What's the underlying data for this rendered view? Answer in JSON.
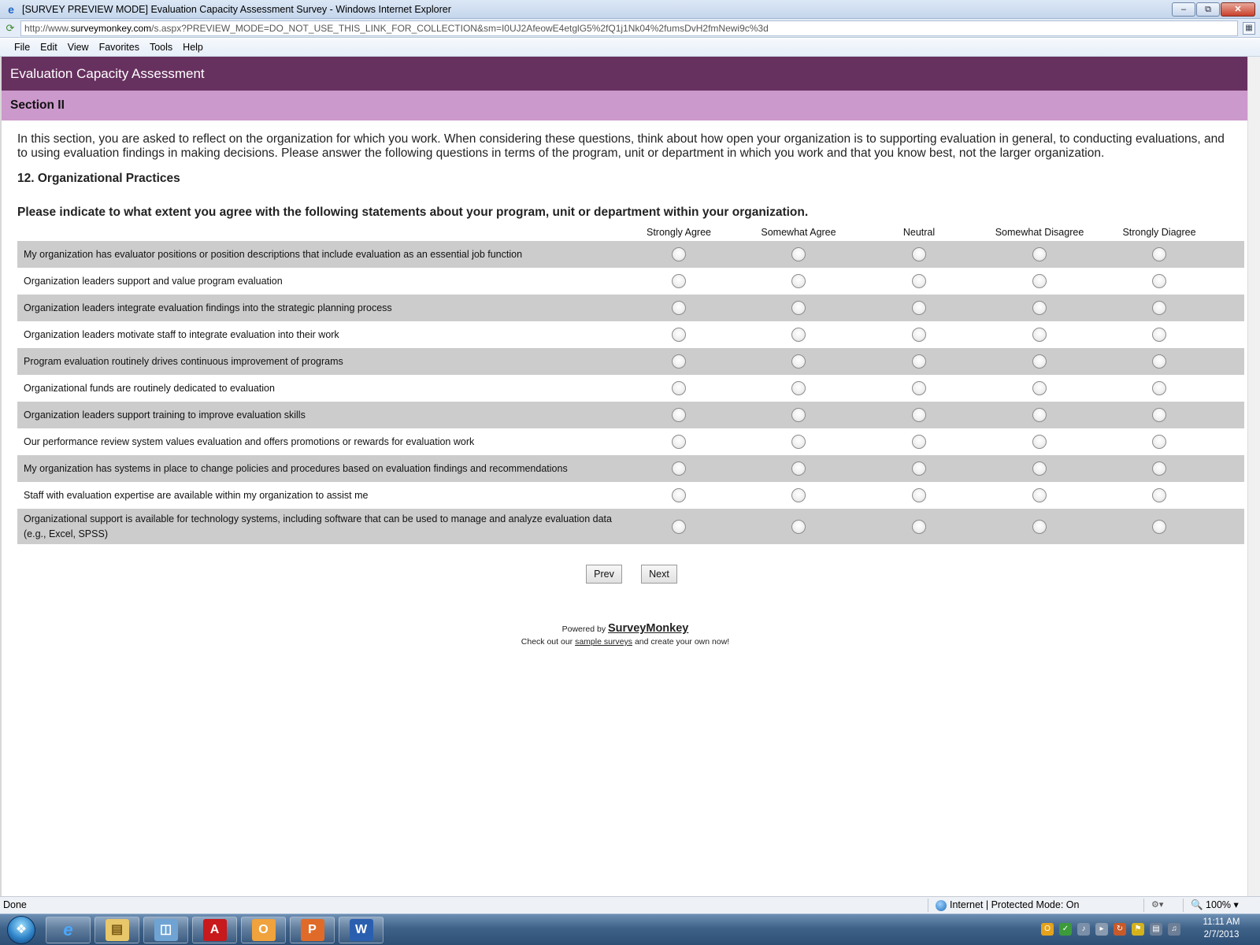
{
  "window": {
    "title": "[SURVEY PREVIEW MODE] Evaluation Capacity Assessment Survey - Windows Internet Explorer",
    "url_prefix": "http://www.",
    "url_host": "surveymonkey.com",
    "url_rest": "/s.aspx?PREVIEW_MODE=DO_NOT_USE_THIS_LINK_FOR_COLLECTION&sm=I0UJ2AfeowE4etglG5%2fQ1j1Nk04%2fumsDvH2fmNewi9c%3d"
  },
  "menu": [
    "File",
    "Edit",
    "View",
    "Favorites",
    "Tools",
    "Help"
  ],
  "survey": {
    "title": "Evaluation Capacity Assessment",
    "section": "Section II",
    "intro": "In this section, you are asked to reflect on the organization for which you work. When considering these questions, think about how open your organization is to supporting evaluation in general, to conducting evaluations, and to using evaluation findings in making decisions. Please answer the following questions in terms of the program, unit or department in which you work and that you know best, not the larger organization.",
    "question_title": "12. Organizational Practices",
    "question_prompt": "Please indicate to what extent you agree with the following statements about your program, unit or department within your organization.",
    "columns": [
      "Strongly Agree",
      "Somewhat Agree",
      "Neutral",
      "Somewhat Disagree",
      "Strongly Diagree"
    ],
    "rows": [
      "My organization has evaluator positions or position descriptions that include evaluation as an essential job function",
      "Organization leaders support and value program evaluation",
      "Organization leaders integrate evaluation findings into the strategic planning process",
      "Organization leaders motivate staff to integrate evaluation into their work",
      "Program evaluation routinely drives continuous improvement of programs",
      "Organizational funds are routinely dedicated to evaluation",
      "Organization leaders support training to improve evaluation skills",
      "Our performance review system values evaluation and offers promotions or rewards for evaluation work",
      "My organization has systems in place to change policies and procedures based on evaluation findings and recommendations",
      "Staff with evaluation expertise are available within my organization to assist me",
      "Organizational support is available for technology systems, including software that can be used to manage and analyze evaluation data (e.g., Excel, SPSS)"
    ],
    "prev_label": "Prev",
    "next_label": "Next",
    "powered_by": "Powered by",
    "brand": "SurveyMonkey",
    "checkout_pre": "Check out our",
    "checkout_link": "sample surveys",
    "checkout_post": "and create your own now!"
  },
  "status": {
    "text": "Done",
    "zone": "Internet | Protected Mode: On",
    "zoom": "100%"
  },
  "clock": {
    "time": "11:11 AM",
    "date": "2/7/2013"
  },
  "colors": {
    "header_bg": "#67315f",
    "section_bg": "#cc99cc",
    "row_alt_bg": "#cccccc"
  }
}
